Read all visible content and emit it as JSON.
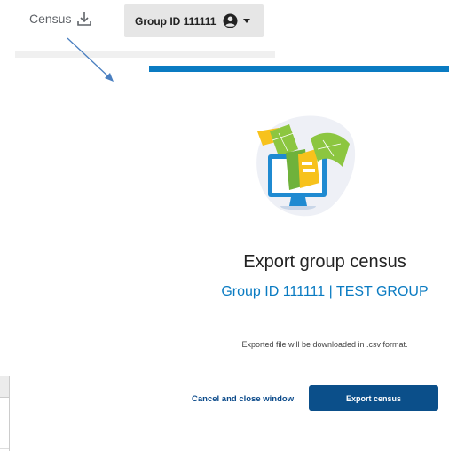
{
  "header": {
    "census_label": "Census",
    "census_icon": "download-icon",
    "group_button_label": "Group ID 111111",
    "user_icon": "user-circle-icon",
    "caret_icon": "caret-down-icon"
  },
  "modal": {
    "title": "Export group census",
    "subtitle": "Group ID 111111 | TEST GROUP",
    "note": "Exported file will be downloaded in .csv format.",
    "cancel_label": "Cancel and close window",
    "export_label": "Export census"
  },
  "colors": {
    "accent_blue": "#0a7bc2",
    "button_navy": "#0b4f8a",
    "link_navy": "#0b4a8a",
    "annotation_arrow": "#4a7fc0"
  }
}
